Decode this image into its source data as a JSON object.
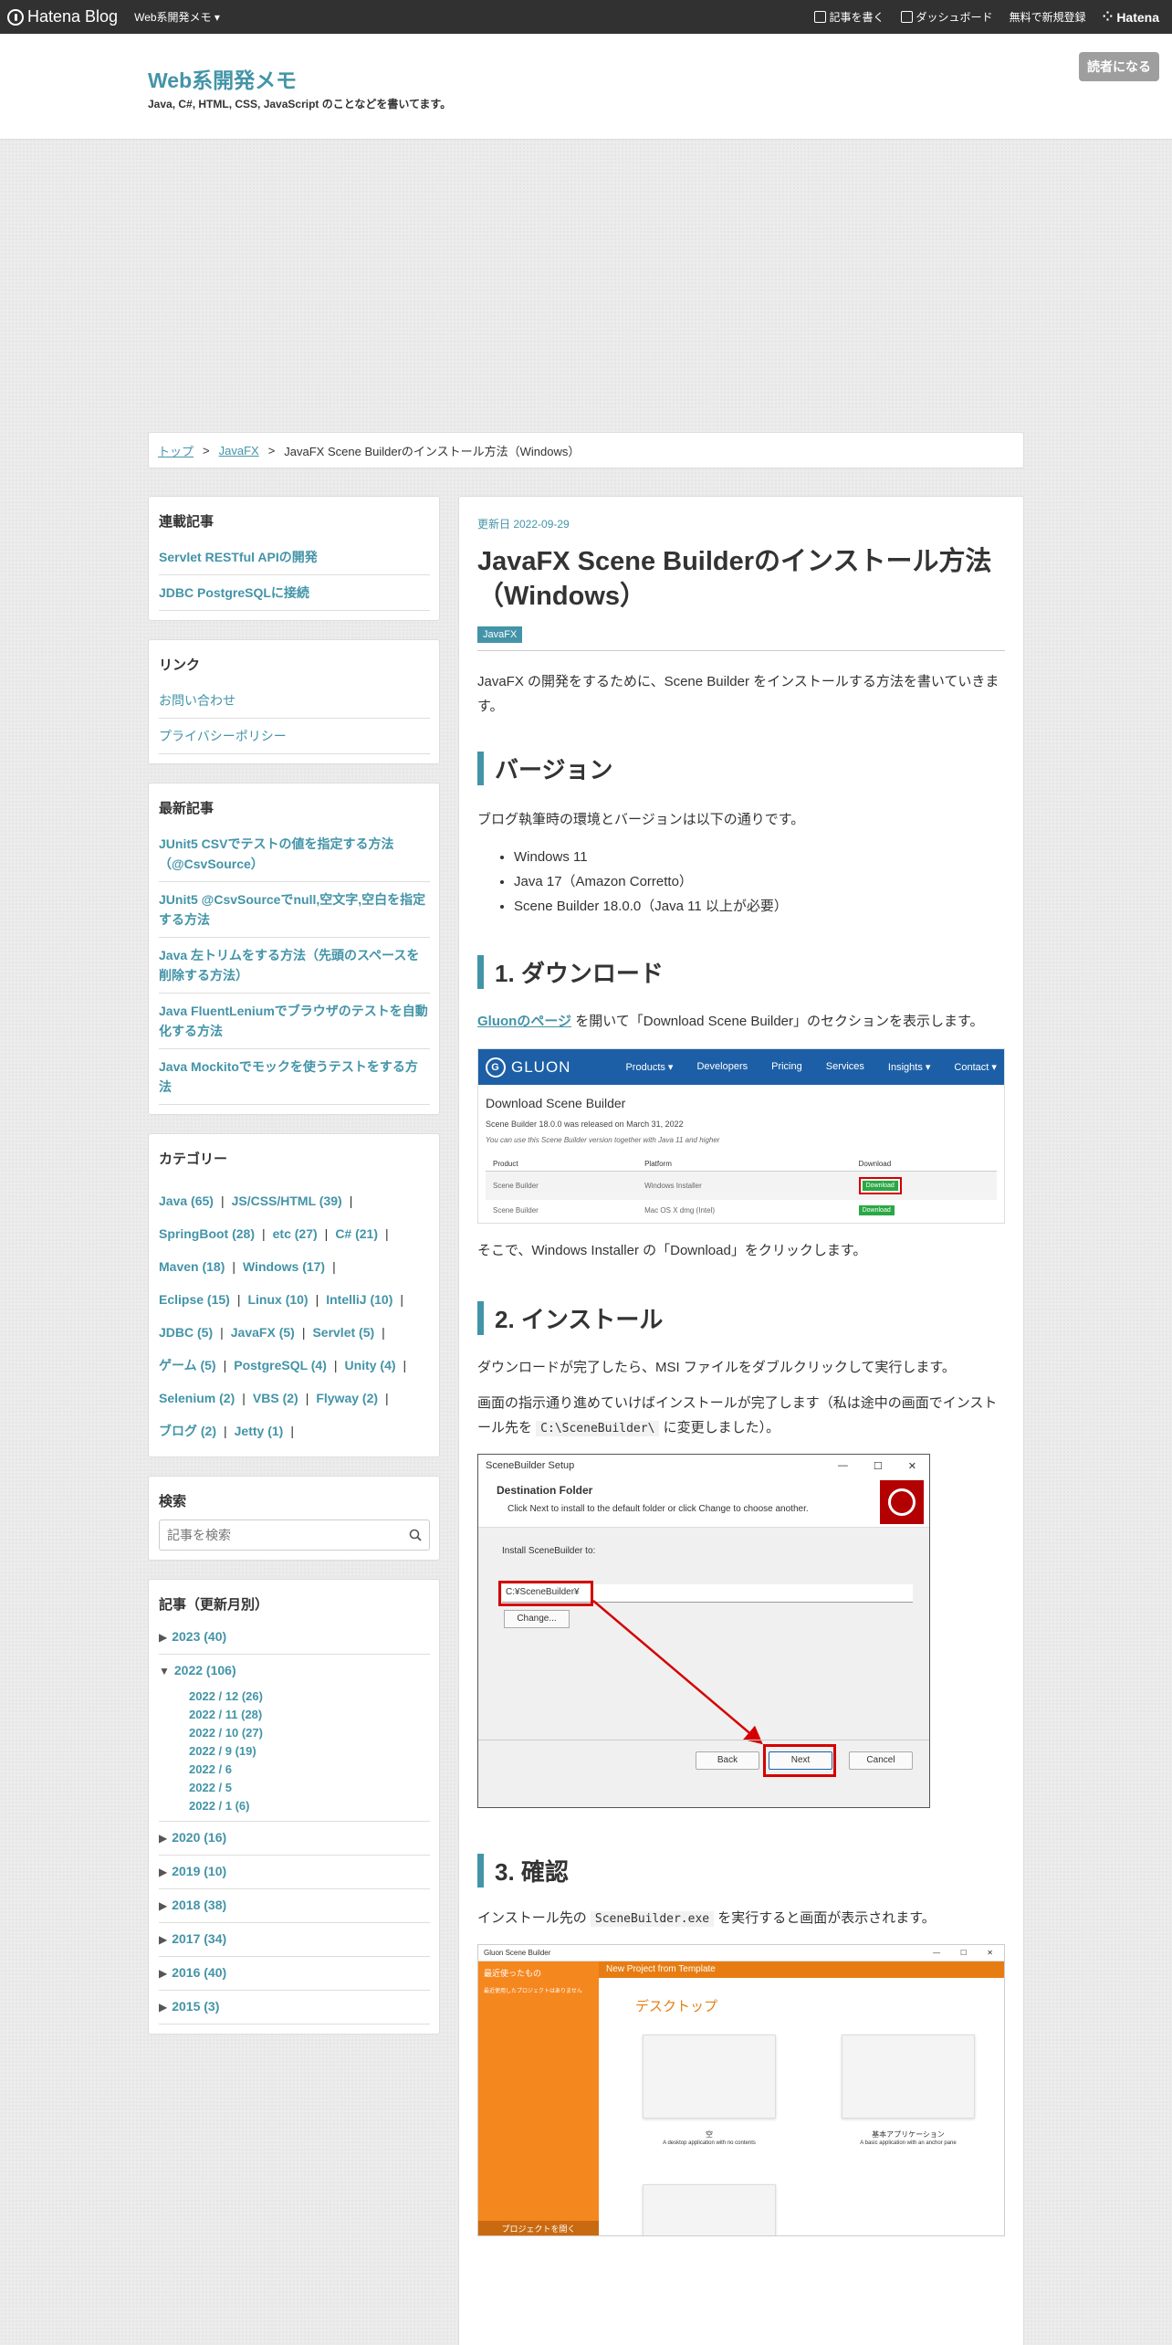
{
  "topbar": {
    "brand": "Hatena Blog",
    "blog_selector": "Web系開発メモ ▾",
    "write": "記事を書く",
    "dashboard": "ダッシュボード",
    "signup": "無料で新規登録",
    "hatena": "Hatena"
  },
  "header": {
    "title": "Web系開発メモ",
    "description": "Java, C#, HTML, CSS, JavaScript のことなどを書いてます。",
    "reader_button": "読者になる"
  },
  "breadcrumb": {
    "top": "トップ",
    "category": "JavaFX",
    "current": "JavaFX Scene Builderのインストール方法（Windows）",
    "sep": ">"
  },
  "sidebar": {
    "series": {
      "title": "連載記事",
      "items": [
        "Servlet RESTful APIの開発",
        "JDBC PostgreSQLに接続"
      ]
    },
    "links": {
      "title": "リンク",
      "items": [
        "お問い合わせ",
        "プライバシーポリシー"
      ]
    },
    "recent": {
      "title": "最新記事",
      "items": [
        "JUnit5 CSVでテストの値を指定する方法（@CsvSource）",
        "JUnit5 @CsvSourceでnull,空文字,空白を指定する方法",
        "Java 左トリムをする方法（先頭のスペースを削除する方法）",
        "Java FluentLeniumでブラウザのテストを自動化する方法",
        "Java Mockitoでモックを使うテストをする方法"
      ]
    },
    "categories": {
      "title": "カテゴリー",
      "rows": [
        [
          "Java (65)",
          "JS/CSS/HTML (39)"
        ],
        [
          "SpringBoot (28)",
          "etc (27)",
          "C# (21)"
        ],
        [
          "Maven (18)",
          "Windows (17)"
        ],
        [
          "Eclipse (15)",
          "Linux (10)",
          "IntelliJ (10)"
        ],
        [
          "JDBC (5)",
          "JavaFX (5)",
          "Servlet (5)"
        ],
        [
          "ゲーム (5)",
          "PostgreSQL (4)",
          "Unity (4)"
        ],
        [
          "Selenium (2)",
          "VBS (2)",
          "Flyway (2)"
        ],
        [
          "ブログ (2)",
          "Jetty (1)"
        ]
      ],
      "sep": "|"
    },
    "search": {
      "title": "検索",
      "placeholder": "記事を検索"
    },
    "archive": {
      "title": "記事（更新月別）",
      "years": [
        {
          "label": "2023 (40)",
          "open": false
        },
        {
          "label": "2022 (106)",
          "open": true,
          "months": [
            "2022 / 12 (26)",
            "2022 / 11 (28)",
            "2022 / 10 (27)",
            "2022 / 9 (19)",
            "2022 / 6",
            "2022 / 5",
            "2022 / 1 (6)"
          ]
        },
        {
          "label": "2020 (16)",
          "open": false
        },
        {
          "label": "2019 (10)",
          "open": false
        },
        {
          "label": "2018 (38)",
          "open": false
        },
        {
          "label": "2017 (34)",
          "open": false
        },
        {
          "label": "2016 (40)",
          "open": false
        },
        {
          "label": "2015 (3)",
          "open": false
        }
      ]
    }
  },
  "article": {
    "updated": "更新日 2022-09-29",
    "title": "JavaFX Scene Builderのインストール方法（Windows）",
    "tag": "JavaFX",
    "intro": "JavaFX の開発をするために、Scene Builder をインストールする方法を書いていきます。",
    "h_version": "バージョン",
    "version_text": "ブログ執筆時の環境とバージョンは以下の通りです。",
    "versions": [
      "Windows 11",
      "Java 17（Amazon Corretto）",
      "Scene Builder 18.0.0（Java 11 以上が必要）"
    ],
    "h_download": "1. ダウンロード",
    "download_link": "Gluonのページ",
    "download_text": " を開いて「Download Scene Builder」のセクションを表示します。",
    "download_after": "そこで、Windows Installer の「Download」をクリックします。",
    "h_install": "2. インストール",
    "install_text1": "ダウンロードが完了したら、MSI ファイルをダブルクリックして実行します。",
    "install_text2a": "画面の指示通り進めていけばインストールが完了します（私は途中の画面でインストール先を ",
    "install_code": "C:\\SceneBuilder\\",
    "install_text2b": " に変更しました）。",
    "h_confirm": "3. 確認",
    "confirm_a": "インストール先の ",
    "confirm_code": "SceneBuilder.exe",
    "confirm_b": " を実行すると画面が表示されます。"
  },
  "gluon_shot": {
    "logo": "GLUON",
    "nav": [
      "Products ▾",
      "Developers",
      "Pricing",
      "Services",
      "Insights ▾",
      "Contact ▾"
    ],
    "heading": "Download Scene Builder",
    "sub": "Scene Builder 18.0.0 was released on March 31, 2022",
    "note": "You can use this Scene Builder version together with Java 11 and higher",
    "headers": [
      "Product",
      "Platform",
      "Download"
    ],
    "rows": [
      [
        "Scene Builder",
        "Windows Installer",
        "Download"
      ],
      [
        "Scene Builder",
        "Mac OS X dmg (Intel)",
        "Download"
      ]
    ]
  },
  "installer_shot": {
    "window_title": "SceneBuilder Setup",
    "head_title": "Destination Folder",
    "head_sub": "Click Next to install to the default folder or click Change to choose another.",
    "label": "Install SceneBuilder to:",
    "path": "C:¥SceneBuilder¥",
    "change": "Change...",
    "back": "Back",
    "next": "Next",
    "cancel": "Cancel"
  },
  "sb_shot": {
    "window_title": "Gluon Scene Builder",
    "left_title": "最近使ったもの",
    "left_sub": "最近使用したプロジェクトはありません",
    "right_head": "New Project from Template",
    "section": "デスクトップ",
    "card1_title": "空",
    "card1_desc": "A desktop application with no contents",
    "card2_title": "基本アプリケーション",
    "card2_desc": "A basic application with an anchor pane",
    "open_project": "プロジェクトを開く"
  },
  "colors": {
    "accent": "#4394a8",
    "topbar": "#313131",
    "gluon_blue": "#1c5fa6",
    "sb_orange": "#f5871f",
    "highlight_red": "#d40000"
  }
}
